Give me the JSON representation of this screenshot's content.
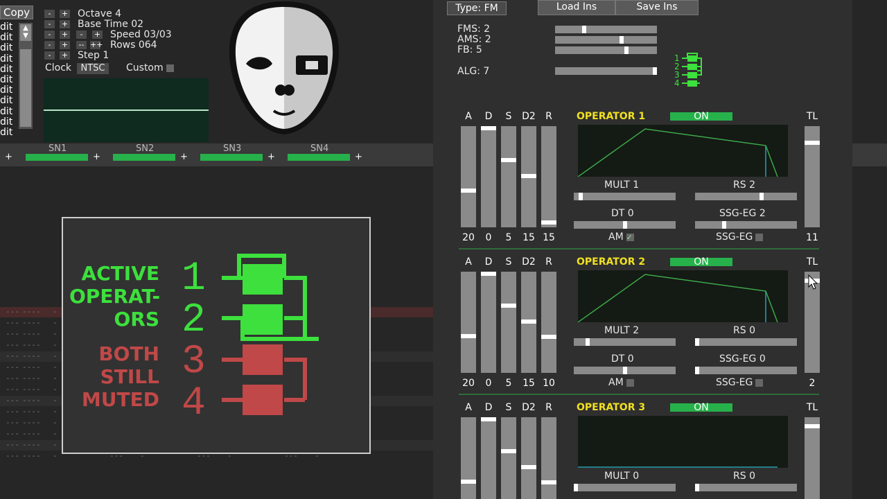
{
  "left": {
    "copy": "Copy",
    "edit_items": [
      "dit",
      "dit",
      "dit",
      "dit",
      "dit",
      "dit",
      "dit",
      "dit",
      "dit",
      "dit",
      "dit"
    ],
    "octave": "Octave 4",
    "base_time": "Base Time 02",
    "speed": "Speed 03/03",
    "rows": "Rows 064",
    "step": "Step 1",
    "clock": "Clock",
    "ntsc": "NTSC",
    "custom": "Custom",
    "channels": [
      "SN1",
      "SN2",
      "SN3",
      "SN4"
    ],
    "dash_cell": "---",
    "short_dash": "-",
    "plus": "+",
    "minus": "-",
    "dbl_minus": "--",
    "dbl_plus": "++"
  },
  "overlay": {
    "active": [
      "ACTIVE",
      "OPERAT-",
      "ORS"
    ],
    "muted": [
      "BOTH",
      "STILL",
      "MUTED"
    ],
    "nums": [
      "1",
      "2",
      "3",
      "4"
    ]
  },
  "right": {
    "type_btn": "Type: FM",
    "load": "Load Ins",
    "save": "Save Ins",
    "fms": "FMS: 2",
    "ams": "AMS: 2",
    "fb": "FB: 5",
    "alg": "ALG: 7",
    "alg_nums": [
      "1",
      "2",
      "3",
      "4"
    ],
    "fms_val": 0.28,
    "ams_val": 0.66,
    "fb_val": 0.71,
    "alg_val": 1.0,
    "col_headers": [
      "A",
      "D",
      "S",
      "D2",
      "R"
    ],
    "tl": "TL",
    "operators": [
      {
        "title": "OPERATOR 1",
        "on": "ON",
        "mult": "MULT 1",
        "rs": "RS 2",
        "dt": "DT 0",
        "ssg": "SSG-EG 2",
        "am": "AM",
        "ssg_chk": "SSG-EG",
        "vals": [
          "20",
          "0",
          "5",
          "15",
          "15"
        ],
        "tl": "11",
        "am_checked": true,
        "knobs": [
          0.64,
          0.0,
          0.33,
          0.49,
          0.97
        ],
        "tl_knob": 0.08,
        "mult_v": 0.05,
        "rs_v": 0.66,
        "dt_v": 0.5,
        "ssg_v": 0.28
      },
      {
        "title": "OPERATOR 2",
        "on": "ON",
        "mult": "MULT 2",
        "rs": "RS 0",
        "dt": "DT 0",
        "ssg": "SSG-EG 0",
        "am": "AM",
        "ssg_chk": "SSG-EG",
        "vals": [
          "20",
          "0",
          "5",
          "15",
          "10"
        ],
        "tl": "2",
        "am_checked": false,
        "knobs": [
          0.64,
          0.0,
          0.33,
          0.49,
          0.65
        ],
        "tl_knob": 0.0,
        "mult_v": 0.12,
        "rs_v": 0.0,
        "dt_v": 0.5,
        "ssg_v": 0.0
      },
      {
        "title": "OPERATOR 3",
        "on": "ON",
        "mult": "MULT 0",
        "rs": "RS 0",
        "vals": [],
        "knobs": [
          0.64,
          0.0,
          0.33,
          0.49,
          0.65
        ],
        "tl_knob": 0.0,
        "mult_v": 0.0,
        "rs_v": 0.0
      }
    ]
  }
}
